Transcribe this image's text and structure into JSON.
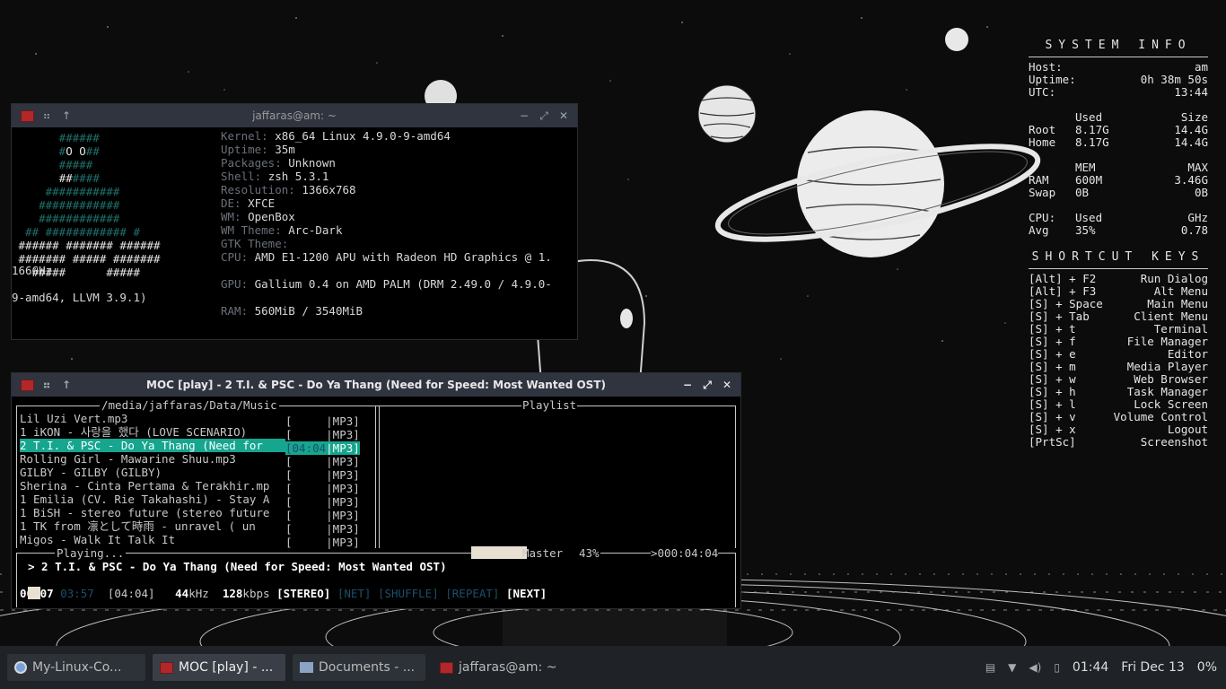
{
  "conky": {
    "system_title": "SYSTEM INFO",
    "host_label": "Host:",
    "host": "am",
    "uptime_label": "Uptime:",
    "uptime": "0h 38m 50s",
    "utc_label": "UTC:",
    "utc": "13:44",
    "disk_used_hdr": "Used",
    "disk_size_hdr": "Size",
    "root_label": "Root",
    "root_used": "8.17G",
    "root_size": "14.4G",
    "home_label": "Home",
    "home_used": "8.17G",
    "home_size": "14.4G",
    "mem_hdr": "MEM",
    "max_hdr": "MAX",
    "ram_label": "RAM",
    "ram_used": "600M",
    "ram_max": "3.46G",
    "swap_label": "Swap",
    "swap_used": "0B",
    "swap_max": "0B",
    "cpu_label": "CPU:",
    "cpu_used_hdr": "Used",
    "ghz_hdr": "GHz",
    "avg_label": "Avg",
    "cpu_pct": "35%",
    "cpu_ghz": "0.78",
    "shortcut_title": "SHORTCUT KEYS",
    "shortcuts": [
      {
        "key": "[Alt] + F2",
        "action": "Run Dialog"
      },
      {
        "key": "[Alt] + F3",
        "action": "Alt Menu"
      },
      {
        "key": "[S] + Space",
        "action": "Main Menu"
      },
      {
        "key": "[S] + Tab",
        "action": "Client Menu"
      },
      {
        "key": "[S] + t",
        "action": "Terminal"
      },
      {
        "key": "[S] + f",
        "action": "File Manager"
      },
      {
        "key": "[S] + e",
        "action": "Editor"
      },
      {
        "key": "[S] + m",
        "action": "Media Player"
      },
      {
        "key": "[S] + w",
        "action": "Web Browser"
      },
      {
        "key": "[S] + h",
        "action": "Task Manager"
      },
      {
        "key": "[S] + l",
        "action": "Lock Screen"
      },
      {
        "key": "[S] + v",
        "action": "Volume Control"
      },
      {
        "key": "[S] + x",
        "action": "Logout"
      },
      {
        "key": "[PrtSc]",
        "action": "Screenshot"
      }
    ]
  },
  "terminal": {
    "title": "jaffaras@am: ~",
    "info": [
      {
        "k": "Kernel:",
        "v": "x86_64 Linux 4.9.0-9-amd64"
      },
      {
        "k": "Uptime:",
        "v": "35m"
      },
      {
        "k": "Packages:",
        "v": "Unknown"
      },
      {
        "k": "Shell:",
        "v": "zsh 5.3.1"
      },
      {
        "k": "Resolution:",
        "v": "1366x768"
      },
      {
        "k": "DE:",
        "v": "XFCE"
      },
      {
        "k": "WM:",
        "v": "OpenBox"
      },
      {
        "k": "WM Theme:",
        "v": "Arc-Dark"
      },
      {
        "k": "GTK Theme:",
        "v": ""
      },
      {
        "k": "CPU:",
        "v": "AMD E1-1200 APU with Radeon HD Graphics @ 1."
      },
      {
        "k": "",
        "v": "166GHz"
      },
      {
        "k": "GPU:",
        "v": "Gallium 0.4 on AMD PALM (DRM 2.49.0 / 4.9.0-"
      },
      {
        "k": "",
        "v": "9-amd64, LLVM 3.9.1)"
      },
      {
        "k": "RAM:",
        "v": "560MiB / 3540MiB"
      }
    ]
  },
  "moc": {
    "title": "MOC [play] - 2 T.I. & PSC - Do Ya Thang (Need for Speed: Most Wanted OST)",
    "dir": "/media/jaffaras/Data/Music",
    "playlist_label": "Playlist",
    "files": [
      {
        "name": "Lil Uzi Vert.mp3",
        "time": "[     ",
        "fmt": "|MP3]"
      },
      {
        "name": "1 iKON - 사랑을 했다 (LOVE SCENARIO)",
        "time": "[     ",
        "fmt": "|MP3]"
      },
      {
        "name": "2 T.I. & PSC - Do Ya Thang (Need for ",
        "time": "[04:04",
        "fmt": "|MP3]",
        "selected": true
      },
      {
        "name": "Rolling Girl - Mawarine Shuu.mp3",
        "time": "[     ",
        "fmt": "|MP3]"
      },
      {
        "name": "GILBY - GILBY (GILBY)",
        "time": "[     ",
        "fmt": "|MP3]"
      },
      {
        "name": "Sherina - Cinta Pertama & Terakhir.mp",
        "time": "[     ",
        "fmt": "|MP3]"
      },
      {
        "name": "1 Emilia (CV. Rie Takahashi) - Stay A",
        "time": "[     ",
        "fmt": "|MP3]"
      },
      {
        "name": "1 BiSH - stereo future (stereo future",
        "time": "[     ",
        "fmt": "|MP3]"
      },
      {
        "name": "1 TK from 凛として時雨 - unravel ( un",
        "time": "[     ",
        "fmt": "|MP3]"
      },
      {
        "name": "Migos - Walk It Talk It",
        "time": "[     ",
        "fmt": "|MP3]"
      }
    ],
    "status": "Playing...",
    "mixer_label": "Master",
    "volume": "43%",
    "volume_fraction": 0.43,
    "total_time": ">000:04:04",
    "now_playing": "> 2 T.I. & PSC - Do Ya Thang (Need for Speed: Most Wanted OST)",
    "elapsed": "00:07",
    "left": "03:57",
    "duration": "[04:04]",
    "rate": "44",
    "rate_unit": "kHz",
    "bitrate": "128",
    "bitrate_unit": "kbps",
    "stereo": "[STEREO]",
    "net": "[NET]",
    "shuffle": "[SHUFFLE]",
    "repeat": "[REPEAT]",
    "next": "[NEXT]"
  },
  "taskbar": {
    "tasks": [
      {
        "label": "My-Linux-Co..."
      },
      {
        "label": "MOC [play] - ..."
      },
      {
        "label": "Documents - ..."
      },
      {
        "label": "jaffaras@am: ~"
      }
    ],
    "clock": "01:44",
    "date": "Fri Dec 13",
    "battery": "0%"
  }
}
